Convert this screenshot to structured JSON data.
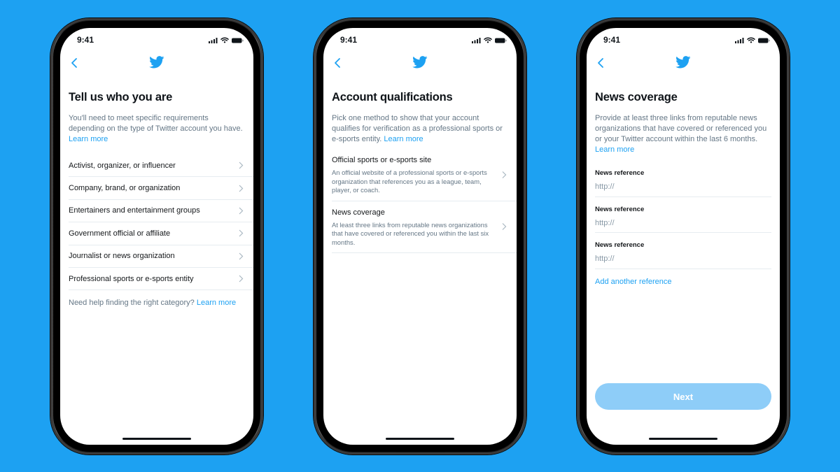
{
  "status_bar": {
    "time": "9:41"
  },
  "colors": {
    "background": "#1DA1F2",
    "accent": "#1DA1F2",
    "next_disabled": "#8ECDF8"
  },
  "screens": [
    {
      "title": "Tell us who you are",
      "description": "You'll need to meet specific requirements depending on the type of Twitter account you have.",
      "learn_more": "Learn more",
      "items": [
        {
          "label": "Activist, organizer, or influencer"
        },
        {
          "label": "Company, brand, or organization"
        },
        {
          "label": "Entertainers and entertainment groups"
        },
        {
          "label": "Government official or affiliate"
        },
        {
          "label": "Journalist or news organization"
        },
        {
          "label": "Professional sports or e-sports entity"
        }
      ],
      "help_text": "Need help finding the right category?",
      "help_link": "Learn more"
    },
    {
      "title": "Account qualifications",
      "description": "Pick one method to show that your account qualifies for verification as a professional sports or e-sports entity.",
      "learn_more": "Learn more",
      "options": [
        {
          "title": "Official sports or e-sports site",
          "subtitle": "An official website of a professional sports or e-sports organization that references you as a league, team, player, or coach."
        },
        {
          "title": "News coverage",
          "subtitle": "At least three links from reputable news organizations that have covered or referenced you within the last six months."
        }
      ]
    },
    {
      "title": "News coverage",
      "description": "Provide at least three links from reputable news organizations that have covered or referenced you or your Twitter account within the last 6 months.",
      "learn_more": "Learn more",
      "fields": [
        {
          "label": "News reference",
          "placeholder": "http://",
          "value": ""
        },
        {
          "label": "News reference",
          "placeholder": "http://",
          "value": ""
        },
        {
          "label": "News reference",
          "placeholder": "http://",
          "value": ""
        }
      ],
      "add_reference": "Add another reference",
      "next_label": "Next"
    }
  ]
}
